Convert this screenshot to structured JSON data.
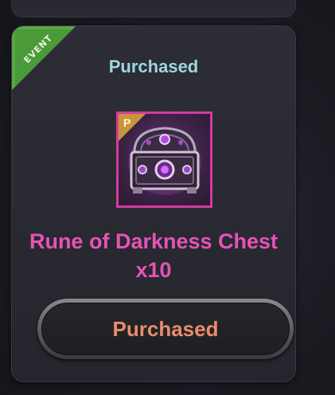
{
  "card": {
    "ribbon_label": "EVENT",
    "status_label": "Purchased",
    "item": {
      "badge_letter": "P",
      "name": "Rune of Darkness Chest",
      "quantity": "x10",
      "icon": "treasure-chest-icon",
      "frame_color": "#d63aa0"
    },
    "button_label": "Purchased"
  },
  "colors": {
    "status_text": "#9fd6e0",
    "item_name": "#e653b8",
    "button_text": "#e98c6c",
    "ribbon": "#4b9a3a"
  }
}
